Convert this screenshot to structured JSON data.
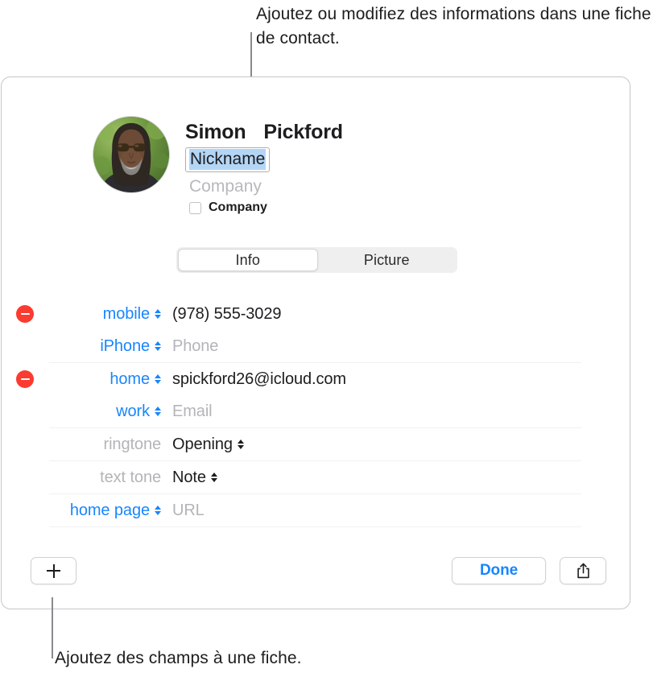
{
  "annotations": {
    "top_callout": "Ajoutez ou modifiez des informations dans une fiche de contact.",
    "bottom_callout": "Ajoutez des champs à une fiche."
  },
  "card": {
    "header": {
      "avatar_alt": "contact-photo",
      "given_name": "Simon",
      "family_name": "Pickford",
      "nickname_placeholder": "Nickname",
      "company_placeholder": "Company",
      "company_checkbox_label": "Company"
    },
    "tabs": [
      {
        "label": "Info",
        "selected": true
      },
      {
        "label": "Picture",
        "selected": false
      }
    ],
    "fields": [
      {
        "removable": true,
        "label": "mobile",
        "label_style": "link",
        "has_label_stepper": true,
        "value": "(978) 555-3029",
        "value_is_placeholder": false,
        "has_value_stepper": false,
        "rule": false
      },
      {
        "removable": false,
        "label": "iPhone",
        "label_style": "link",
        "has_label_stepper": true,
        "value": "Phone",
        "value_is_placeholder": true,
        "has_value_stepper": false,
        "rule": true
      },
      {
        "removable": true,
        "label": "home",
        "label_style": "link",
        "has_label_stepper": true,
        "value": "spickford26@icloud.com",
        "value_is_placeholder": false,
        "has_value_stepper": false,
        "rule": false
      },
      {
        "removable": false,
        "label": "work",
        "label_style": "link",
        "has_label_stepper": true,
        "value": "Email",
        "value_is_placeholder": true,
        "has_value_stepper": false,
        "rule": true
      },
      {
        "removable": false,
        "label": "ringtone",
        "label_style": "static",
        "has_label_stepper": false,
        "value": "Opening",
        "value_is_placeholder": false,
        "has_value_stepper": true,
        "rule": true
      },
      {
        "removable": false,
        "label": "text tone",
        "label_style": "static",
        "has_label_stepper": false,
        "value": "Note",
        "value_is_placeholder": false,
        "has_value_stepper": true,
        "rule": true
      },
      {
        "removable": false,
        "label": "home page",
        "label_style": "link",
        "has_label_stepper": true,
        "value": "URL",
        "value_is_placeholder": true,
        "has_value_stepper": false,
        "rule": true
      }
    ],
    "toolbar": {
      "add_field_icon": "plus-icon",
      "done_label": "Done",
      "share_icon": "share-icon"
    }
  },
  "colors": {
    "accent_blue": "#1886fe",
    "remove_red": "#fc3b30",
    "selection_blue": "#b4d6f6",
    "placeholder_gray": "#b4b4b9",
    "rule_gray": "#f1f1f2",
    "card_border": "#c6c6c8",
    "segment_track": "#efeff0"
  }
}
